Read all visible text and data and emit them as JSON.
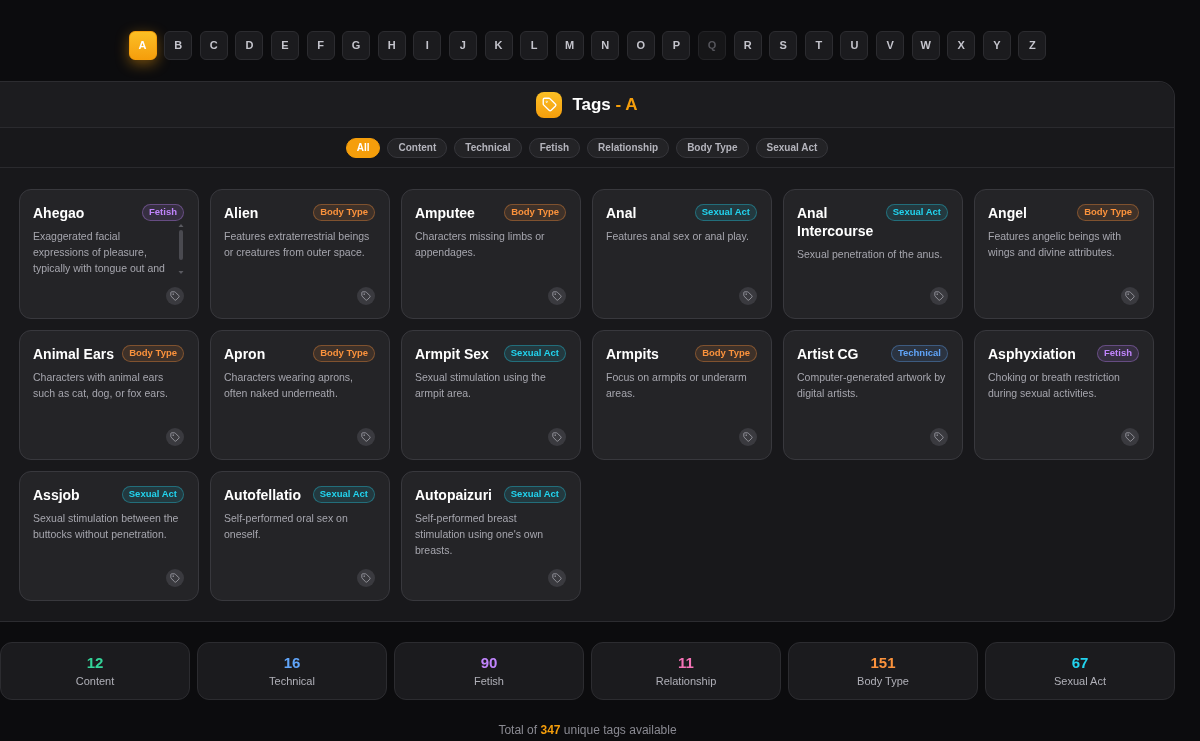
{
  "alphabet": [
    {
      "letter": "A",
      "selected": true,
      "disabled": false
    },
    {
      "letter": "B",
      "selected": false,
      "disabled": false
    },
    {
      "letter": "C",
      "selected": false,
      "disabled": false
    },
    {
      "letter": "D",
      "selected": false,
      "disabled": false
    },
    {
      "letter": "E",
      "selected": false,
      "disabled": false
    },
    {
      "letter": "F",
      "selected": false,
      "disabled": false
    },
    {
      "letter": "G",
      "selected": false,
      "disabled": false
    },
    {
      "letter": "H",
      "selected": false,
      "disabled": false
    },
    {
      "letter": "I",
      "selected": false,
      "disabled": false
    },
    {
      "letter": "J",
      "selected": false,
      "disabled": false
    },
    {
      "letter": "K",
      "selected": false,
      "disabled": false
    },
    {
      "letter": "L",
      "selected": false,
      "disabled": false
    },
    {
      "letter": "M",
      "selected": false,
      "disabled": false
    },
    {
      "letter": "N",
      "selected": false,
      "disabled": false
    },
    {
      "letter": "O",
      "selected": false,
      "disabled": false
    },
    {
      "letter": "P",
      "selected": false,
      "disabled": false
    },
    {
      "letter": "Q",
      "selected": false,
      "disabled": true
    },
    {
      "letter": "R",
      "selected": false,
      "disabled": false
    },
    {
      "letter": "S",
      "selected": false,
      "disabled": false
    },
    {
      "letter": "T",
      "selected": false,
      "disabled": false
    },
    {
      "letter": "U",
      "selected": false,
      "disabled": false
    },
    {
      "letter": "V",
      "selected": false,
      "disabled": false
    },
    {
      "letter": "W",
      "selected": false,
      "disabled": false
    },
    {
      "letter": "X",
      "selected": false,
      "disabled": false
    },
    {
      "letter": "Y",
      "selected": false,
      "disabled": false
    },
    {
      "letter": "Z",
      "selected": false,
      "disabled": false
    }
  ],
  "panel": {
    "title": "Tags",
    "suffix": "- A"
  },
  "filters": [
    {
      "label": "All",
      "selected": true
    },
    {
      "label": "Content",
      "selected": false
    },
    {
      "label": "Technical",
      "selected": false
    },
    {
      "label": "Fetish",
      "selected": false
    },
    {
      "label": "Relationship",
      "selected": false
    },
    {
      "label": "Body Type",
      "selected": false
    },
    {
      "label": "Sexual Act",
      "selected": false
    }
  ],
  "tags": [
    {
      "name": "Ahegao",
      "category": "Fetish",
      "color": "#c084fc",
      "description": "Exaggerated facial expressions of pleasure, typically with tongue out and",
      "scrollable": true
    },
    {
      "name": "Alien",
      "category": "Body Type",
      "color": "#fb923c",
      "description": "Features extraterrestrial beings or creatures from outer space.",
      "scrollable": false
    },
    {
      "name": "Amputee",
      "category": "Body Type",
      "color": "#fb923c",
      "description": "Characters missing limbs or appendages.",
      "scrollable": false
    },
    {
      "name": "Anal",
      "category": "Sexual Act",
      "color": "#22d3ee",
      "description": "Features anal sex or anal play.",
      "scrollable": false
    },
    {
      "name": "Anal Intercourse",
      "category": "Sexual Act",
      "color": "#22d3ee",
      "description": "Sexual penetration of the anus.",
      "scrollable": false
    },
    {
      "name": "Angel",
      "category": "Body Type",
      "color": "#fb923c",
      "description": "Features angelic beings with wings and divine attributes.",
      "scrollable": false
    },
    {
      "name": "Animal Ears",
      "category": "Body Type",
      "color": "#fb923c",
      "description": "Characters with animal ears such as cat, dog, or fox ears.",
      "scrollable": false
    },
    {
      "name": "Apron",
      "category": "Body Type",
      "color": "#fb923c",
      "description": "Characters wearing aprons, often naked underneath.",
      "scrollable": false
    },
    {
      "name": "Armpit Sex",
      "category": "Sexual Act",
      "color": "#22d3ee",
      "description": "Sexual stimulation using the armpit area.",
      "scrollable": false
    },
    {
      "name": "Armpits",
      "category": "Body Type",
      "color": "#fb923c",
      "description": "Focus on armpits or underarm areas.",
      "scrollable": false
    },
    {
      "name": "Artist CG",
      "category": "Technical",
      "color": "#60a5fa",
      "description": "Computer-generated artwork by digital artists.",
      "scrollable": false
    },
    {
      "name": "Asphyxiation",
      "category": "Fetish",
      "color": "#c084fc",
      "description": "Choking or breath restriction during sexual activities.",
      "scrollable": false
    },
    {
      "name": "Assjob",
      "category": "Sexual Act",
      "color": "#22d3ee",
      "description": "Sexual stimulation between the buttocks without penetration.",
      "scrollable": false
    },
    {
      "name": "Autofellatio",
      "category": "Sexual Act",
      "color": "#22d3ee",
      "description": "Self-performed oral sex on oneself.",
      "scrollable": false
    },
    {
      "name": "Autopaizuri",
      "category": "Sexual Act",
      "color": "#22d3ee",
      "description": "Self-performed breast stimulation using one's own breasts.",
      "scrollable": false
    }
  ],
  "stats": [
    {
      "count": "12",
      "label": "Content",
      "color": "#34d399"
    },
    {
      "count": "16",
      "label": "Technical",
      "color": "#60a5fa"
    },
    {
      "count": "90",
      "label": "Fetish",
      "color": "#c084fc"
    },
    {
      "count": "11",
      "label": "Relationship",
      "color": "#f472b6"
    },
    {
      "count": "151",
      "label": "Body Type",
      "color": "#fb923c"
    },
    {
      "count": "67",
      "label": "Sexual Act",
      "color": "#22d3ee"
    }
  ],
  "footer": {
    "text": "Total of **347** unique tags available"
  }
}
